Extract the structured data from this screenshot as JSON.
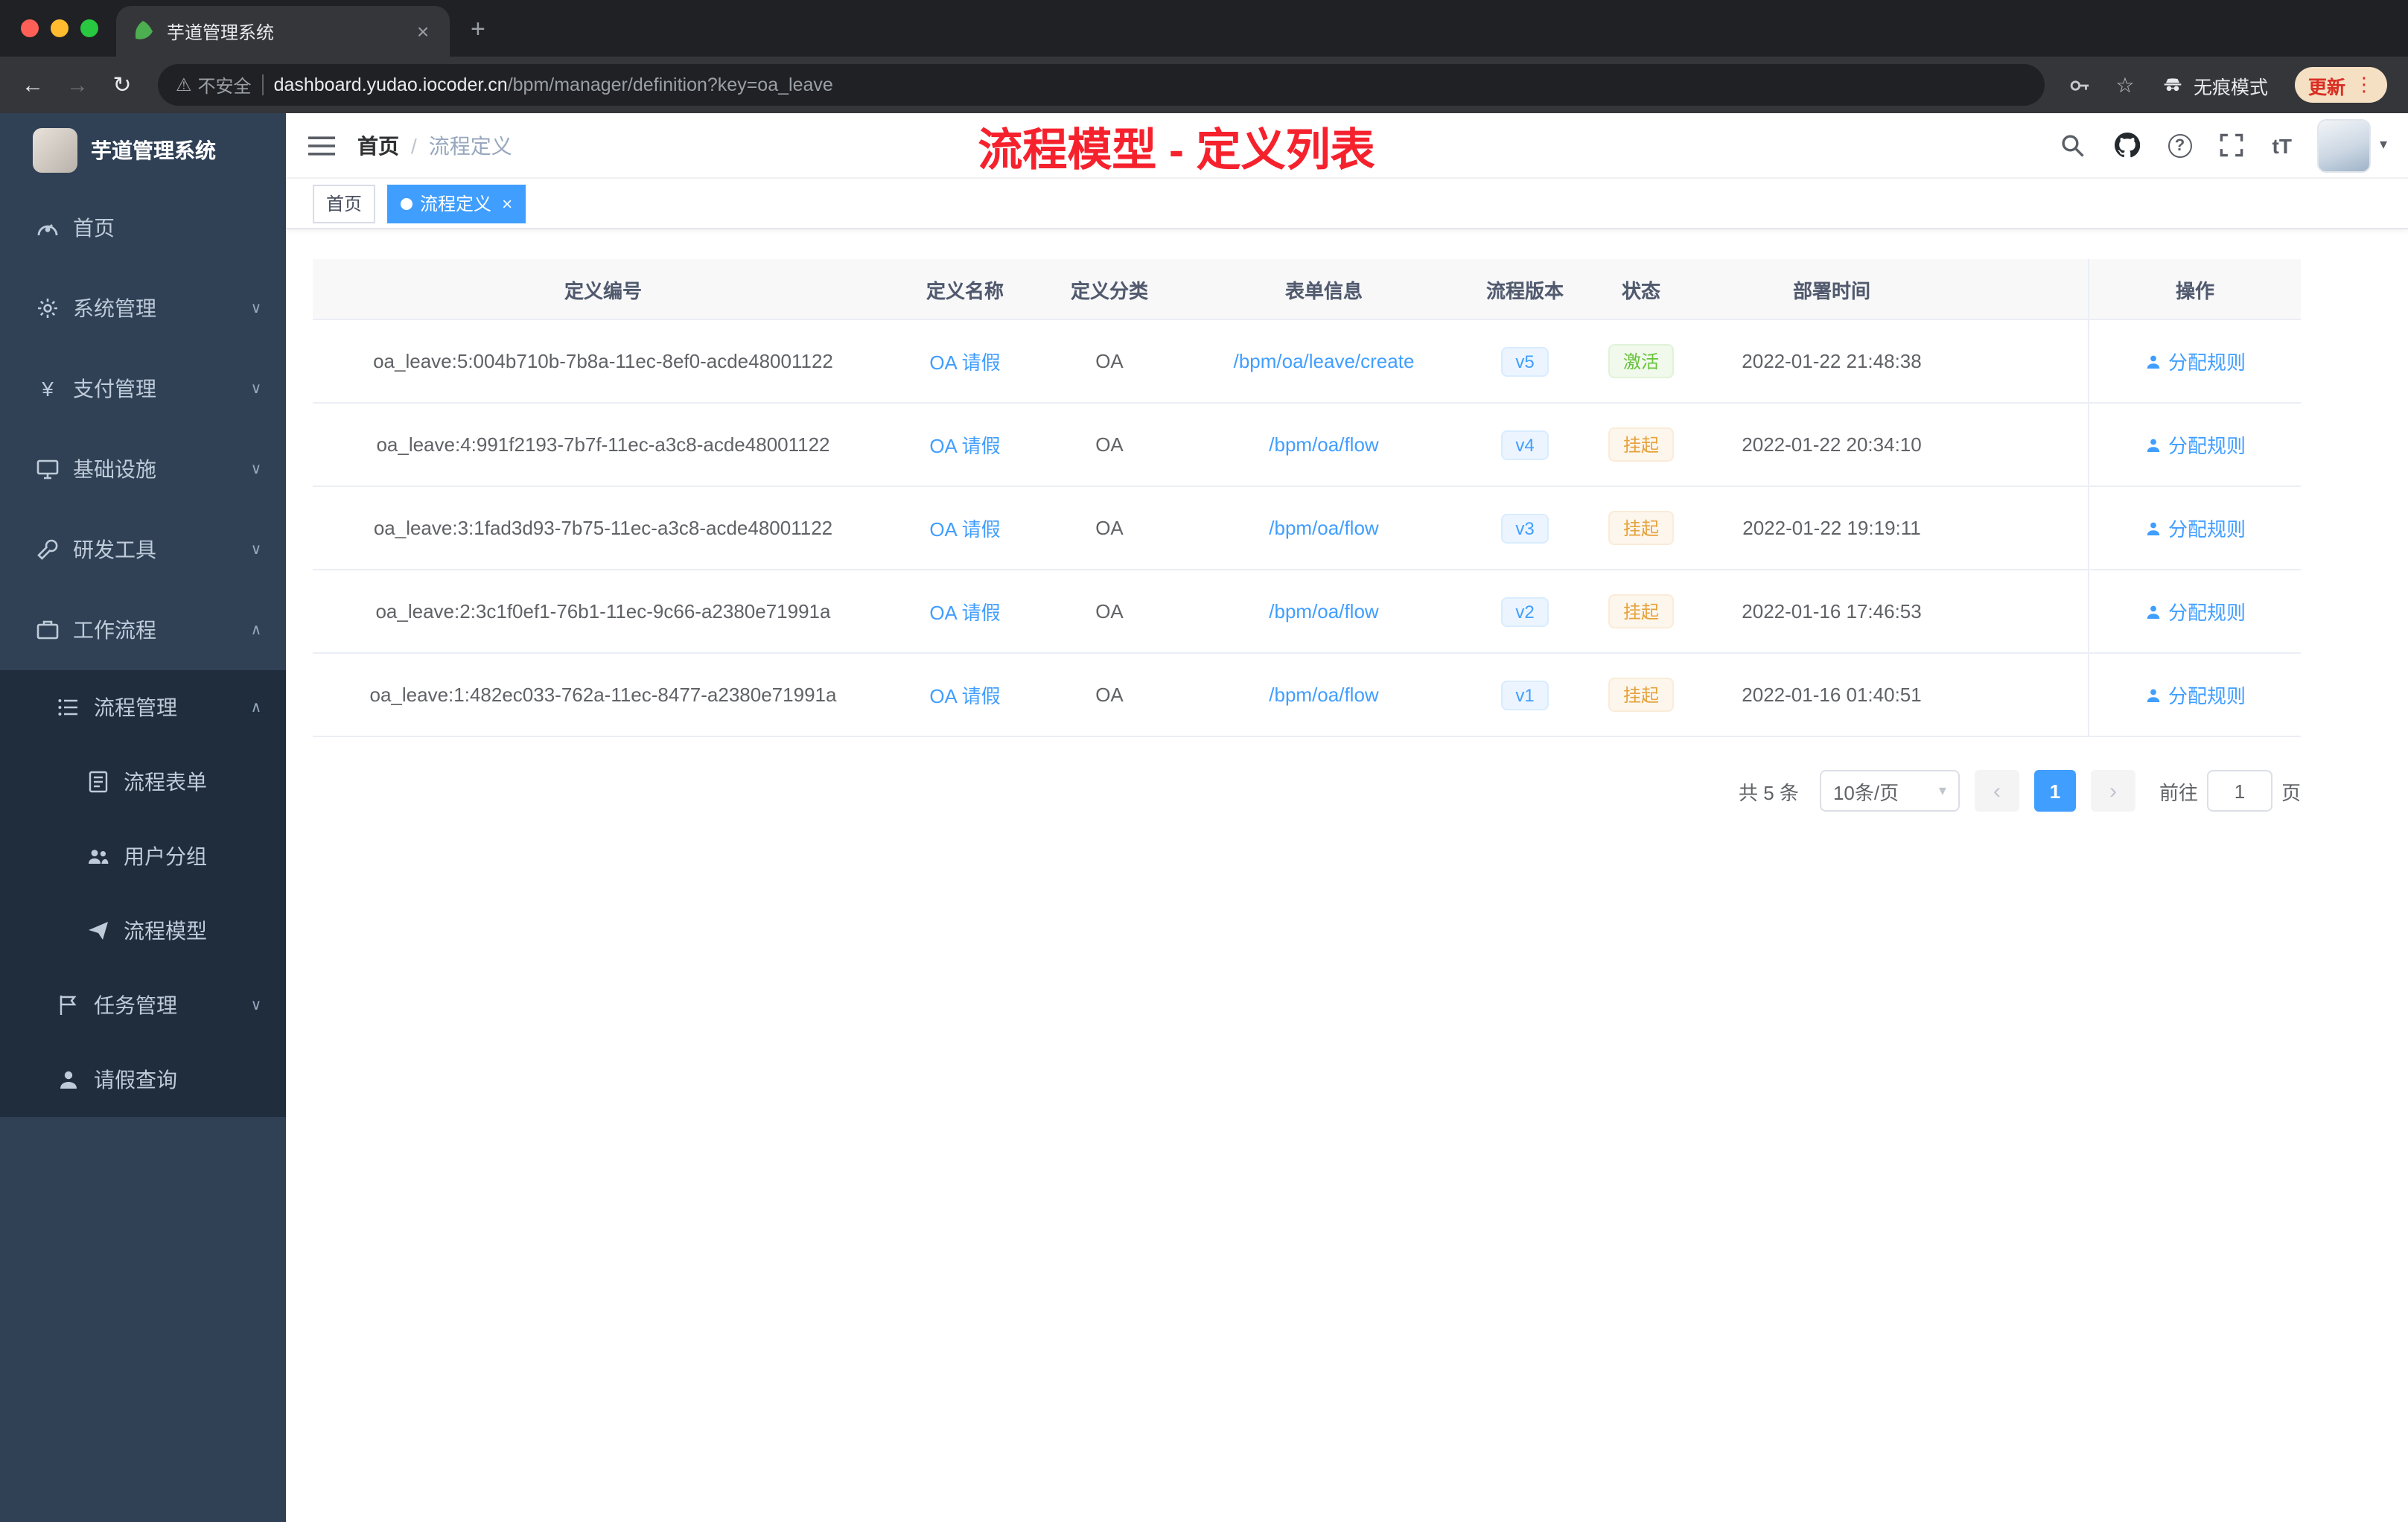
{
  "colors": {
    "accent": "#409eff",
    "success": "#67c23a",
    "warning": "#e6a23c",
    "annotation_red": "#f5222d",
    "sidebar_bg": "#304156",
    "submenu_bg": "#1f2d3d"
  },
  "icons": {
    "back": "←",
    "forward": "→",
    "reload": "↻",
    "warning": "⚠",
    "star": "☆",
    "kebab": "⋮",
    "tab_close": "×",
    "new_tab": "+",
    "caret_down": "▾",
    "chevron_down": "∨",
    "chevron_up": "∧",
    "help": "?",
    "font_size": "tT",
    "yen": "¥"
  },
  "browser": {
    "tab_title": "芋道管理系统",
    "security_label": "不安全",
    "url_domain": "dashboard.yudao.iocoder.cn",
    "url_path": "/bpm/manager/definition?key=oa_leave",
    "incognito_label": "无痕模式",
    "update_label": "更新"
  },
  "sidebar": {
    "logo_title": "芋道管理系统",
    "items": [
      {
        "label": "首页"
      },
      {
        "label": "系统管理"
      },
      {
        "label": "支付管理"
      },
      {
        "label": "基础设施"
      },
      {
        "label": "研发工具"
      },
      {
        "label": "工作流程"
      },
      {
        "label": "流程管理"
      },
      {
        "label": "流程表单"
      },
      {
        "label": "用户分组"
      },
      {
        "label": "流程模型"
      },
      {
        "label": "任务管理"
      },
      {
        "label": "请假查询"
      }
    ]
  },
  "header": {
    "breadcrumb_home": "首页",
    "breadcrumb_sep": "/",
    "breadcrumb_current": "流程定义",
    "annotation": "流程模型 - 定义列表"
  },
  "tags": {
    "home": "首页",
    "active": "流程定义"
  },
  "table": {
    "columns": {
      "id": "定义编号",
      "name": "定义名称",
      "category": "定义分类",
      "form": "表单信息",
      "version": "流程版本",
      "status": "状态",
      "deploy_time": "部署时间",
      "action": "操作"
    },
    "rows": [
      {
        "id": "oa_leave:5:004b710b-7b8a-11ec-8ef0-acde48001122",
        "name": "OA 请假",
        "category": "OA",
        "form": "/bpm/oa/leave/create",
        "version": "v5",
        "status": "激活",
        "status_type": "success",
        "deploy_time": "2022-01-22 21:48:38",
        "action": "分配规则"
      },
      {
        "id": "oa_leave:4:991f2193-7b7f-11ec-a3c8-acde48001122",
        "name": "OA 请假",
        "category": "OA",
        "form": "/bpm/oa/flow",
        "version": "v4",
        "status": "挂起",
        "status_type": "warning",
        "deploy_time": "2022-01-22 20:34:10",
        "action": "分配规则"
      },
      {
        "id": "oa_leave:3:1fad3d93-7b75-11ec-a3c8-acde48001122",
        "name": "OA 请假",
        "category": "OA",
        "form": "/bpm/oa/flow",
        "version": "v3",
        "status": "挂起",
        "status_type": "warning",
        "deploy_time": "2022-01-22 19:19:11",
        "action": "分配规则"
      },
      {
        "id": "oa_leave:2:3c1f0ef1-76b1-11ec-9c66-a2380e71991a",
        "name": "OA 请假",
        "category": "OA",
        "form": "/bpm/oa/flow",
        "version": "v2",
        "status": "挂起",
        "status_type": "warning",
        "deploy_time": "2022-01-16 17:46:53",
        "action": "分配规则"
      },
      {
        "id": "oa_leave:1:482ec033-762a-11ec-8477-a2380e71991a",
        "name": "OA 请假",
        "category": "OA",
        "form": "/bpm/oa/flow",
        "version": "v1",
        "status": "挂起",
        "status_type": "warning",
        "deploy_time": "2022-01-16 01:40:51",
        "action": "分配规则"
      }
    ]
  },
  "pagination": {
    "total": "共 5 条",
    "page_size": "10条/页",
    "prev": "‹",
    "current_page": "1",
    "next": "›",
    "goto_prefix": "前往",
    "goto_value": "1",
    "goto_suffix": "页"
  }
}
